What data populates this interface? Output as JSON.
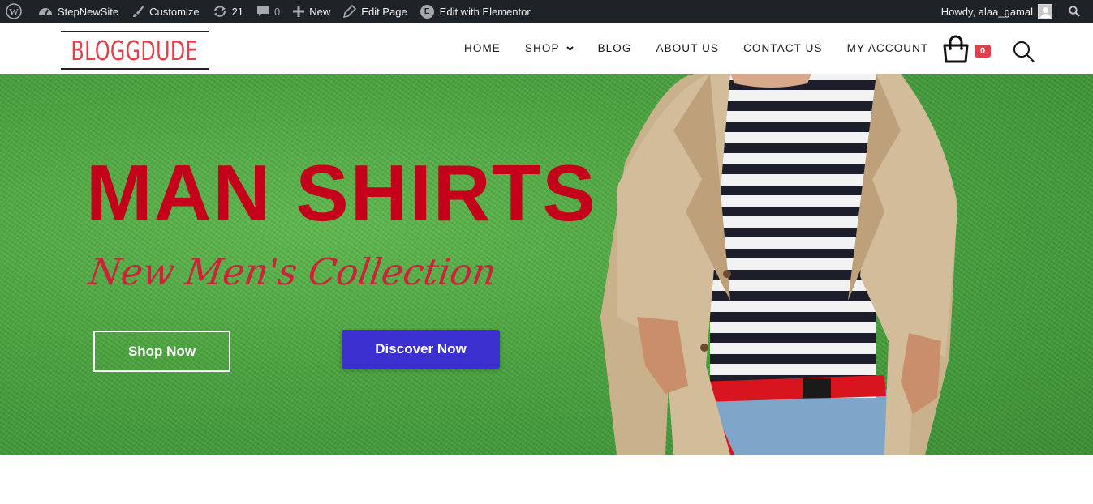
{
  "admin_bar": {
    "site_name": "StepNewSite",
    "customize": "Customize",
    "updates_count": "21",
    "comments_count": "0",
    "new_label": "New",
    "edit_page": "Edit Page",
    "edit_elementor": "Edit with Elementor",
    "elementor_icon_letter": "E",
    "howdy": "Howdy, alaa_gamal"
  },
  "header": {
    "logo": "BLOGGDUDE",
    "nav": [
      "HOME",
      "SHOP",
      "BLOG",
      "ABOUT US",
      "CONTACT US",
      "MY ACCOUNT"
    ],
    "cart_count": "0",
    "icons": [
      "cart-bag-icon",
      "search-icon",
      "chevron-down-icon"
    ]
  },
  "hero": {
    "title": "MAN SHIRTS",
    "subtitle": "New Men's Collection",
    "shop_button": "Shop Now",
    "discover_button": "Discover Now"
  },
  "colors": {
    "admin_bar_bg": "#1d2327",
    "accent_red": "#c4001a",
    "logo_red": "#e0404a",
    "discover_blue": "#3b2fd0",
    "grass_green": "#46a23a"
  }
}
